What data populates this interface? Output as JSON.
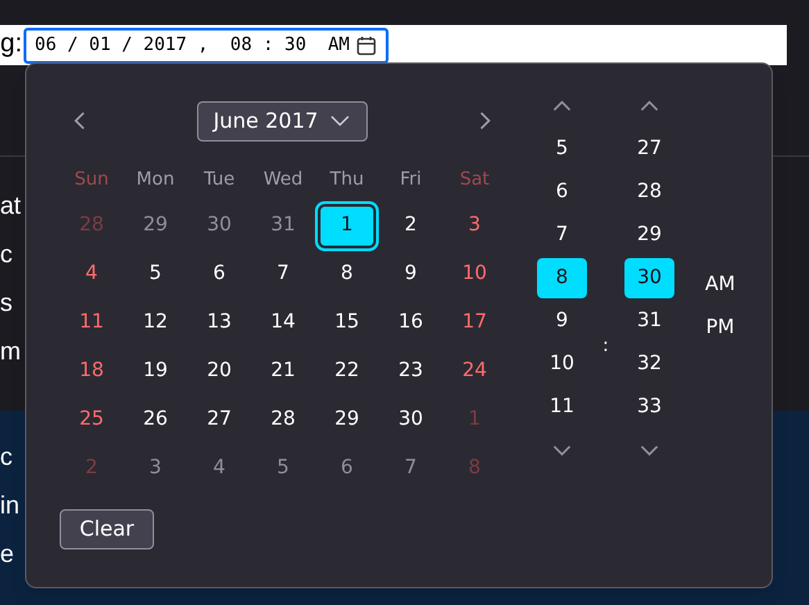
{
  "page": {
    "field_label": "g:",
    "fragments_dark": [
      "at",
      "c",
      "s",
      "m"
    ],
    "fragments_blue": [
      "c",
      "in",
      "e"
    ]
  },
  "input": {
    "value": "06 / 01 / 2017 ,  08 : 30  AM",
    "focused": true
  },
  "picker": {
    "month_label": "June 2017",
    "weekdays": [
      {
        "label": "Sun",
        "weekend": true
      },
      {
        "label": "Mon",
        "weekend": false
      },
      {
        "label": "Tue",
        "weekend": false
      },
      {
        "label": "Wed",
        "weekend": false
      },
      {
        "label": "Thu",
        "weekend": false
      },
      {
        "label": "Fri",
        "weekend": false
      },
      {
        "label": "Sat",
        "weekend": true
      }
    ],
    "weeks": [
      [
        {
          "label": "28",
          "in_month": false,
          "selected": false
        },
        {
          "label": "29",
          "in_month": false,
          "selected": false
        },
        {
          "label": "30",
          "in_month": false,
          "selected": false
        },
        {
          "label": "31",
          "in_month": false,
          "selected": false
        },
        {
          "label": "1",
          "in_month": true,
          "selected": true
        },
        {
          "label": "2",
          "in_month": true,
          "selected": false
        },
        {
          "label": "3",
          "in_month": true,
          "selected": false
        }
      ],
      [
        {
          "label": "4",
          "in_month": true,
          "selected": false
        },
        {
          "label": "5",
          "in_month": true,
          "selected": false
        },
        {
          "label": "6",
          "in_month": true,
          "selected": false
        },
        {
          "label": "7",
          "in_month": true,
          "selected": false
        },
        {
          "label": "8",
          "in_month": true,
          "selected": false
        },
        {
          "label": "9",
          "in_month": true,
          "selected": false
        },
        {
          "label": "10",
          "in_month": true,
          "selected": false
        }
      ],
      [
        {
          "label": "11",
          "in_month": true,
          "selected": false
        },
        {
          "label": "12",
          "in_month": true,
          "selected": false
        },
        {
          "label": "13",
          "in_month": true,
          "selected": false
        },
        {
          "label": "14",
          "in_month": true,
          "selected": false
        },
        {
          "label": "15",
          "in_month": true,
          "selected": false
        },
        {
          "label": "16",
          "in_month": true,
          "selected": false
        },
        {
          "label": "17",
          "in_month": true,
          "selected": false
        }
      ],
      [
        {
          "label": "18",
          "in_month": true,
          "selected": false
        },
        {
          "label": "19",
          "in_month": true,
          "selected": false
        },
        {
          "label": "20",
          "in_month": true,
          "selected": false
        },
        {
          "label": "21",
          "in_month": true,
          "selected": false
        },
        {
          "label": "22",
          "in_month": true,
          "selected": false
        },
        {
          "label": "23",
          "in_month": true,
          "selected": false
        },
        {
          "label": "24",
          "in_month": true,
          "selected": false
        }
      ],
      [
        {
          "label": "25",
          "in_month": true,
          "selected": false
        },
        {
          "label": "26",
          "in_month": true,
          "selected": false
        },
        {
          "label": "27",
          "in_month": true,
          "selected": false
        },
        {
          "label": "28",
          "in_month": true,
          "selected": false
        },
        {
          "label": "29",
          "in_month": true,
          "selected": false
        },
        {
          "label": "30",
          "in_month": true,
          "selected": false
        },
        {
          "label": "1",
          "in_month": false,
          "selected": false
        }
      ],
      [
        {
          "label": "2",
          "in_month": false,
          "selected": false
        },
        {
          "label": "3",
          "in_month": false,
          "selected": false
        },
        {
          "label": "4",
          "in_month": false,
          "selected": false
        },
        {
          "label": "5",
          "in_month": false,
          "selected": false
        },
        {
          "label": "6",
          "in_month": false,
          "selected": false
        },
        {
          "label": "7",
          "in_month": false,
          "selected": false
        },
        {
          "label": "8",
          "in_month": false,
          "selected": false
        }
      ]
    ],
    "clear_button": "Clear",
    "hours": [
      {
        "label": "5",
        "selected": false
      },
      {
        "label": "6",
        "selected": false
      },
      {
        "label": "7",
        "selected": false
      },
      {
        "label": "8",
        "selected": true
      },
      {
        "label": "9",
        "selected": false
      },
      {
        "label": "10",
        "selected": false
      },
      {
        "label": "11",
        "selected": false
      }
    ],
    "separator": ":",
    "minutes": [
      {
        "label": "27",
        "selected": false
      },
      {
        "label": "28",
        "selected": false
      },
      {
        "label": "29",
        "selected": false
      },
      {
        "label": "30",
        "selected": true
      },
      {
        "label": "31",
        "selected": false
      },
      {
        "label": "32",
        "selected": false
      },
      {
        "label": "33",
        "selected": false
      }
    ],
    "meridiem": [
      {
        "label": "AM",
        "selected": false
      },
      {
        "label": "PM",
        "selected": false
      }
    ]
  }
}
